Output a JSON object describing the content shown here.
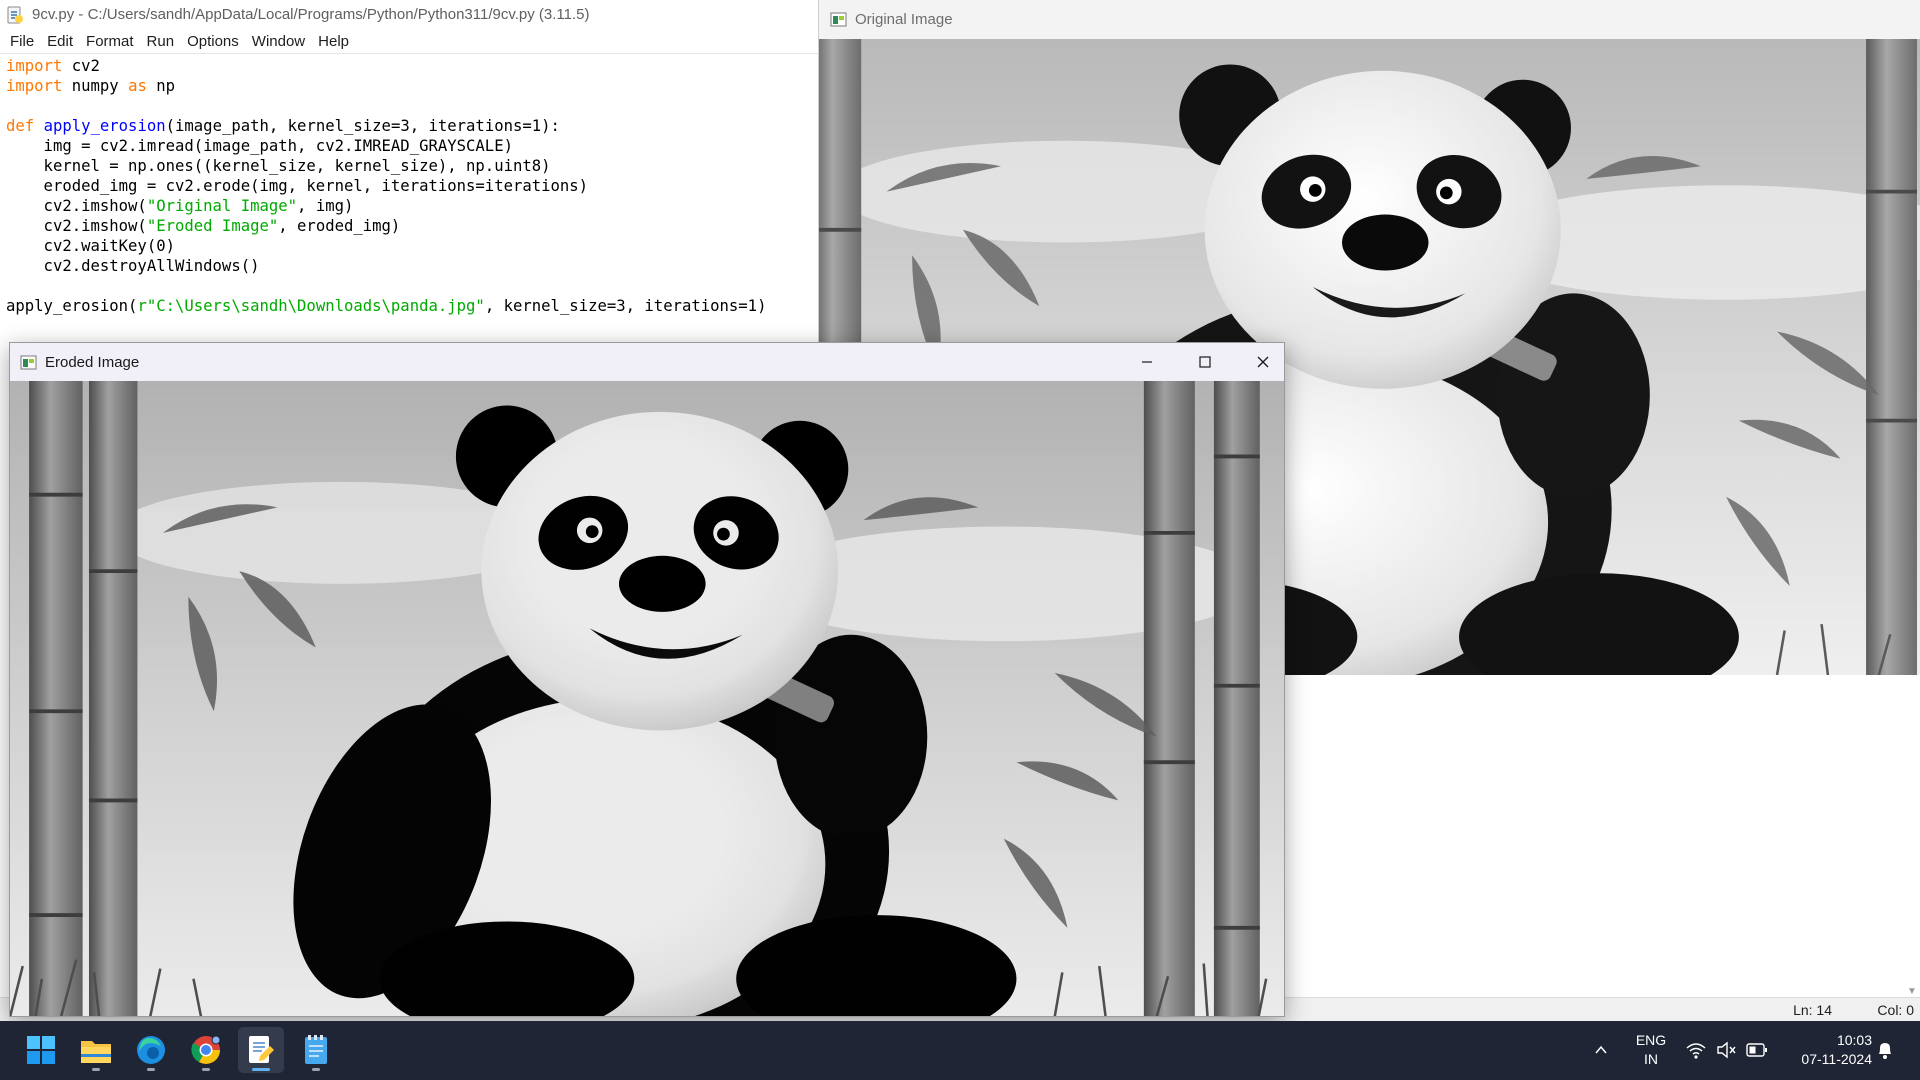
{
  "idle": {
    "title": "9cv.py - C:/Users/sandh/AppData/Local/Programs/Python/Python311/9cv.py (3.11.5)",
    "menu": [
      "File",
      "Edit",
      "Format",
      "Run",
      "Options",
      "Window",
      "Help"
    ],
    "code": [
      [
        {
          "t": "import",
          "c": "kw"
        },
        {
          "t": " cv2"
        }
      ],
      [
        {
          "t": "import",
          "c": "kw"
        },
        {
          "t": " numpy "
        },
        {
          "t": "as",
          "c": "kw"
        },
        {
          "t": " np"
        }
      ],
      [],
      [
        {
          "t": "def",
          "c": "kw"
        },
        {
          "t": " "
        },
        {
          "t": "apply_erosion",
          "c": "fn"
        },
        {
          "t": "(image_path, kernel_size=3, iterations=1):"
        }
      ],
      [
        {
          "t": "    img = cv2.imread(image_path, cv2.IMREAD_GRAYSCALE)"
        }
      ],
      [
        {
          "t": "    kernel = np.ones((kernel_size, kernel_size), np.uint8)"
        }
      ],
      [
        {
          "t": "    eroded_img = cv2.erode(img, kernel, iterations=iterations)"
        }
      ],
      [
        {
          "t": "    cv2.imshow("
        },
        {
          "t": "\"Original Image\"",
          "c": "str"
        },
        {
          "t": ", img)"
        }
      ],
      [
        {
          "t": "    cv2.imshow("
        },
        {
          "t": "\"Eroded Image\"",
          "c": "str"
        },
        {
          "t": ", eroded_img)"
        }
      ],
      [
        {
          "t": "    cv2.waitKey(0)"
        }
      ],
      [
        {
          "t": "    cv2.destroyAllWindows()"
        }
      ],
      [],
      [
        {
          "t": "apply_erosion("
        },
        {
          "t": "r\"C:\\Users\\sandh\\Downloads\\panda.jpg\"",
          "c": "str"
        },
        {
          "t": ", kernel_size=3, iterations=1)"
        }
      ]
    ],
    "status": {
      "ln": "Ln: 14",
      "col": "Col: 0"
    }
  },
  "original_window": {
    "title": "Original Image",
    "icon": "opencv-window-icon"
  },
  "eroded_window": {
    "title": "Eroded Image",
    "icon": "opencv-window-icon",
    "controls": [
      "minimize-icon",
      "maximize-icon",
      "close-icon"
    ]
  },
  "taskbar": {
    "apps": [
      "windows-start-icon",
      "file-explorer-icon",
      "edge-icon",
      "chrome-icon",
      "python-idle-icon",
      "notepad-icon"
    ],
    "tray": {
      "lang_top": "ENG",
      "lang_bottom": "IN",
      "time": "10:03",
      "date": "07-11-2024"
    }
  },
  "colors": {
    "keyword": "#ff7700",
    "function": "#0000ff",
    "string": "#00aa00",
    "taskbar": "#1f2535"
  }
}
